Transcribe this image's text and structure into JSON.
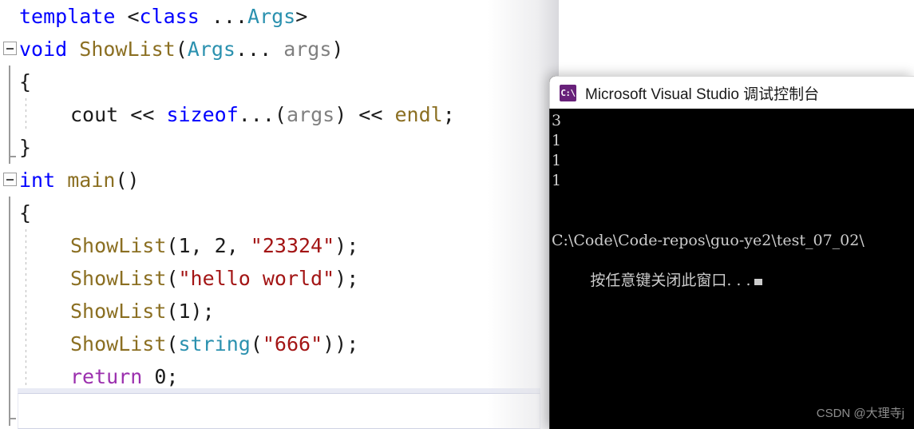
{
  "editor": {
    "name": "visual-studio-code-editor",
    "lines": [
      {
        "indent": 1,
        "fold": "none",
        "tokens": [
          {
            "t": "template ",
            "c": "kw"
          },
          {
            "t": "<",
            "c": "punc"
          },
          {
            "t": "class",
            "c": "kw"
          },
          {
            "t": " ...",
            "c": "punc"
          },
          {
            "t": "Args",
            "c": "type"
          },
          {
            "t": ">",
            "c": "punc"
          }
        ]
      },
      {
        "indent": 0,
        "fold": "start",
        "tokens": [
          {
            "t": "void",
            "c": "kw"
          },
          {
            "t": " ",
            "c": "plain"
          },
          {
            "t": "ShowList",
            "c": "fn"
          },
          {
            "t": "(",
            "c": "punc"
          },
          {
            "t": "Args",
            "c": "type"
          },
          {
            "t": "... ",
            "c": "punc"
          },
          {
            "t": "args",
            "c": "ident"
          },
          {
            "t": ")",
            "c": "punc"
          }
        ]
      },
      {
        "indent": 1,
        "fold": "bar",
        "tokens": [
          {
            "t": "{",
            "c": "plain"
          }
        ]
      },
      {
        "indent": 2,
        "fold": "bar-dash",
        "tokens": [
          {
            "t": "cout",
            "c": "plain"
          },
          {
            "t": " << ",
            "c": "plain"
          },
          {
            "t": "sizeof",
            "c": "kw"
          },
          {
            "t": "...",
            "c": "punc"
          },
          {
            "t": "(",
            "c": "punc"
          },
          {
            "t": "args",
            "c": "ident"
          },
          {
            "t": ")",
            "c": "punc"
          },
          {
            "t": " << ",
            "c": "plain"
          },
          {
            "t": "endl",
            "c": "fn"
          },
          {
            "t": ";",
            "c": "plain"
          }
        ]
      },
      {
        "indent": 1,
        "fold": "bar-end",
        "tokens": [
          {
            "t": "}",
            "c": "plain"
          }
        ]
      },
      {
        "indent": 0,
        "fold": "start",
        "tokens": [
          {
            "t": "int",
            "c": "kw"
          },
          {
            "t": " ",
            "c": "plain"
          },
          {
            "t": "main",
            "c": "fn"
          },
          {
            "t": "()",
            "c": "punc"
          }
        ]
      },
      {
        "indent": 1,
        "fold": "bar",
        "tokens": [
          {
            "t": "{",
            "c": "plain"
          }
        ]
      },
      {
        "indent": 2,
        "fold": "bar-dash",
        "tokens": [
          {
            "t": "ShowList",
            "c": "fn"
          },
          {
            "t": "(",
            "c": "punc"
          },
          {
            "t": "1, 2, ",
            "c": "plain"
          },
          {
            "t": "\"23324\"",
            "c": "str"
          },
          {
            "t": ");",
            "c": "punc"
          }
        ]
      },
      {
        "indent": 2,
        "fold": "bar-dash",
        "tokens": [
          {
            "t": "ShowList",
            "c": "fn"
          },
          {
            "t": "(",
            "c": "punc"
          },
          {
            "t": "\"hello world\"",
            "c": "str"
          },
          {
            "t": ");",
            "c": "punc"
          }
        ]
      },
      {
        "indent": 2,
        "fold": "bar-dash",
        "tokens": [
          {
            "t": "ShowList",
            "c": "fn"
          },
          {
            "t": "(",
            "c": "punc"
          },
          {
            "t": "1",
            "c": "plain"
          },
          {
            "t": ");",
            "c": "punc"
          }
        ]
      },
      {
        "indent": 2,
        "fold": "bar-dash",
        "tokens": [
          {
            "t": "ShowList",
            "c": "fn"
          },
          {
            "t": "(",
            "c": "punc"
          },
          {
            "t": "string",
            "c": "type"
          },
          {
            "t": "(",
            "c": "punc"
          },
          {
            "t": "\"666\"",
            "c": "str"
          },
          {
            "t": "));",
            "c": "punc"
          }
        ]
      },
      {
        "indent": 2,
        "fold": "bar-dash",
        "tokens": [
          {
            "t": "return",
            "c": "ret"
          },
          {
            "t": " 0;",
            "c": "plain"
          }
        ]
      },
      {
        "indent": 1,
        "fold": "bar-end",
        "current": true,
        "tokens": [
          {
            "t": "}",
            "c": "plain"
          }
        ]
      }
    ]
  },
  "console": {
    "title": "Microsoft Visual Studio 调试控制台",
    "icon_label": "C:\\",
    "output": [
      "3",
      "1",
      "1",
      "1",
      "",
      "",
      "C:\\Code\\Code-repos\\guo-ye2\\test_07_02\\"
    ],
    "prompt_line": "按任意键关闭此窗口. . .",
    "cursor_visible": true
  },
  "watermark": {
    "text": "CSDN @大理寺j"
  },
  "colors": {
    "keyword": "#0000ff",
    "type": "#2b91af",
    "function": "#8b6f22",
    "identifier": "#808080",
    "string": "#a31515",
    "return": "#9b2fae",
    "console_bg": "#000000",
    "console_fg": "#cccccc",
    "icon_bg": "#68217a"
  }
}
